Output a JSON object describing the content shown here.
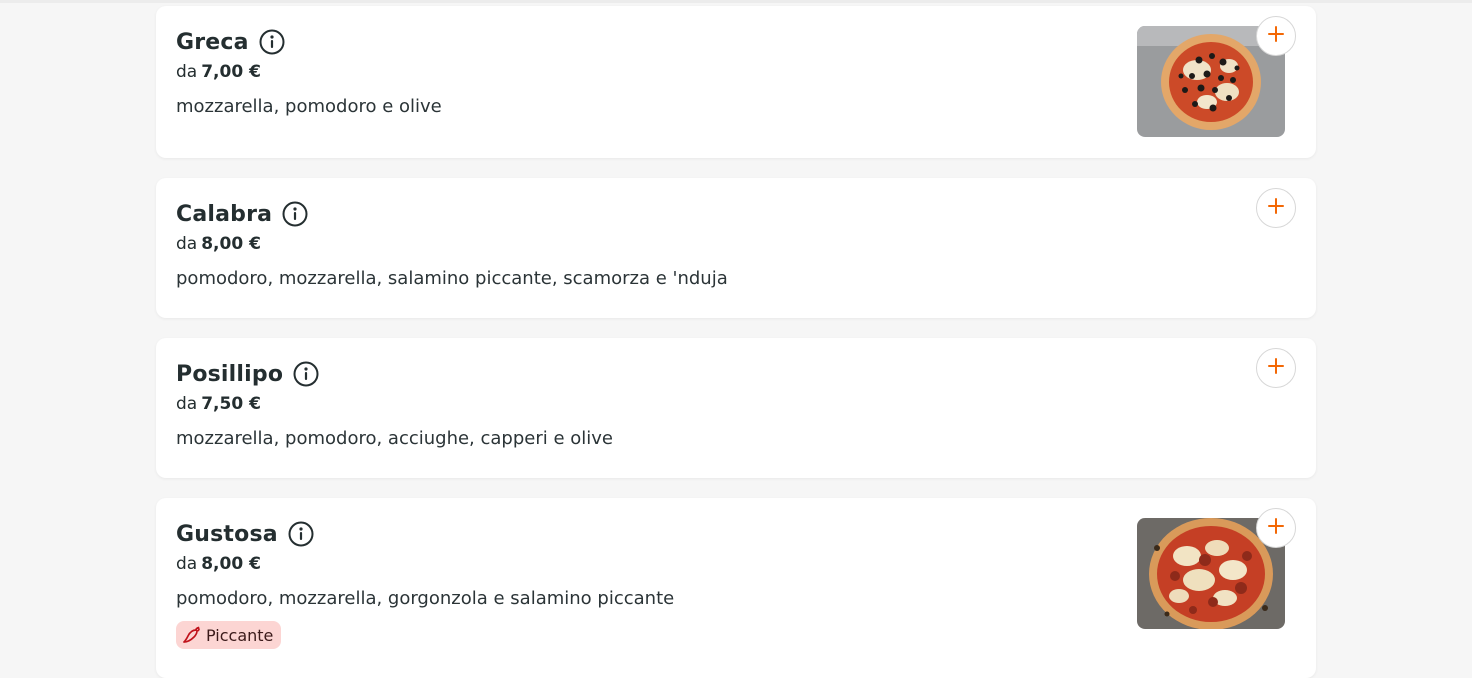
{
  "menu": {
    "price_prefix": "da",
    "items": [
      {
        "name": "Greca",
        "price": "7,00 €",
        "description": "mozzarella, pomodoro e olive",
        "image": "pizza-olive-photo"
      },
      {
        "name": "Calabra",
        "price": "8,00 €",
        "description": "pomodoro, mozzarella, salamino piccante, scamorza e 'nduja"
      },
      {
        "name": "Posillipo",
        "price": "7,50 €",
        "description": "mozzarella, pomodoro, acciughe, capperi e olive"
      },
      {
        "name": "Gustosa",
        "price": "8,00 €",
        "description": "pomodoro, mozzarella, gorgonzola e salamino piccante",
        "image": "pizza-gorgonzola-salami-photo",
        "badge": "Piccante"
      }
    ]
  },
  "colors": {
    "accent": "#f36805",
    "badge_bg": "#fcd5d3",
    "chili": "#c0121b"
  },
  "icons": {
    "info": "info-circle-icon",
    "add": "plus-icon",
    "badge": "chili-pepper-icon"
  }
}
